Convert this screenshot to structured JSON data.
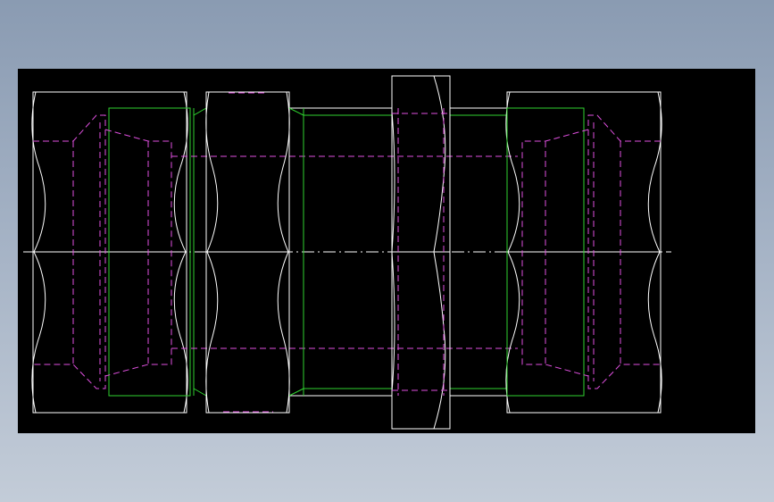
{
  "canvas": {
    "background_color": "#000000",
    "desktop_color": "#a3b1c4"
  },
  "drawing": {
    "type": "cad-2d-assembly-drawing",
    "layers": {
      "outline": "#ffffff",
      "thread_body": "#2fd22f",
      "hidden_lines": "#e050e0"
    },
    "parts": [
      "left-hex-nut",
      "left-hex-body",
      "center-hex",
      "right-hex-nut",
      "center-tube"
    ]
  }
}
